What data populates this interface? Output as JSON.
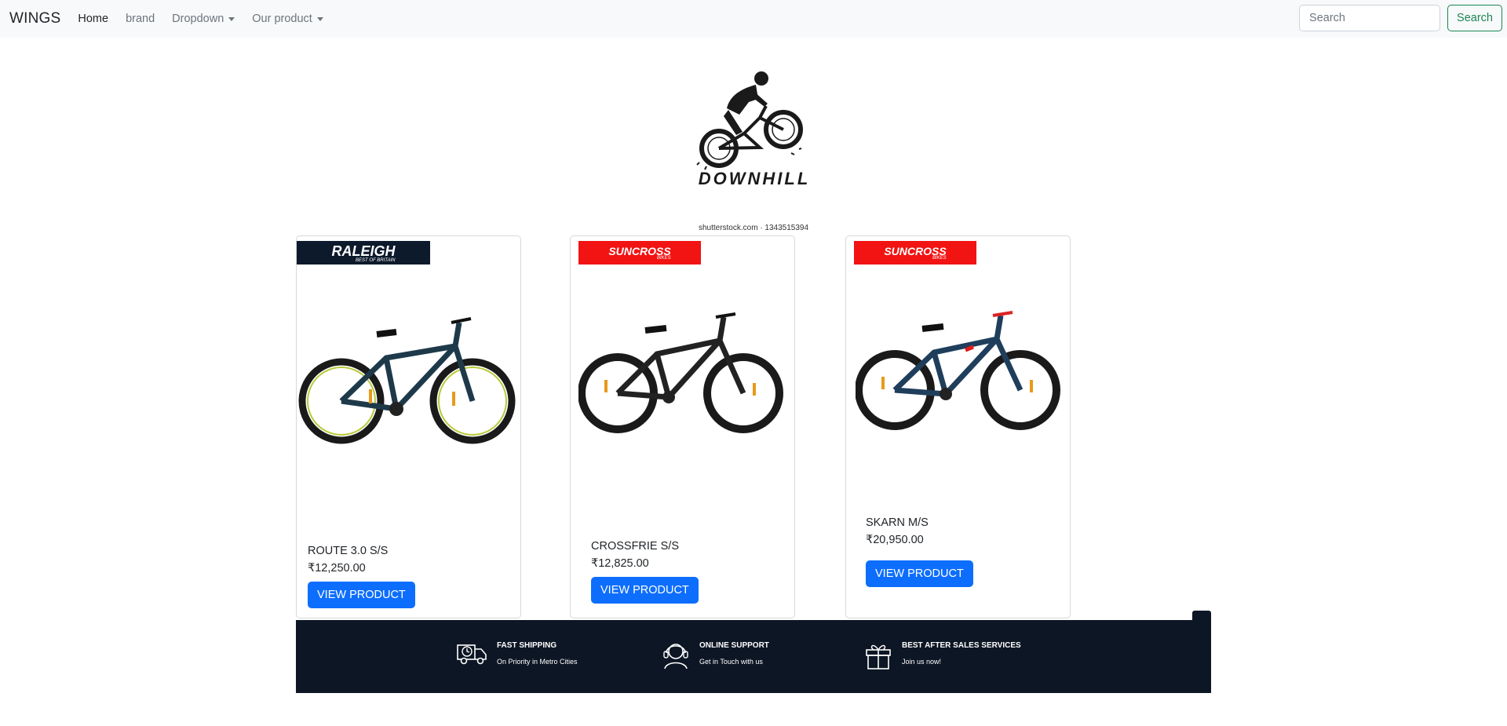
{
  "navbar": {
    "brand": "WINGS",
    "links": [
      {
        "label": "Home"
      },
      {
        "label": "brand"
      },
      {
        "label": "Dropdown"
      },
      {
        "label": "Our product"
      }
    ],
    "search": {
      "placeholder": "Search",
      "button": "Search"
    }
  },
  "hero": {
    "logo_text": "DOWNHILL",
    "caption": "shutterstock.com · 1343515394"
  },
  "products": [
    {
      "brand_badge": "RALEIGH",
      "brand_tagline": "BEST OF BRITAIN",
      "name": "ROUTE 3.0 S/S",
      "price": "₹12,250.00",
      "button": "VIEW PRODUCT"
    },
    {
      "brand_badge": "SUNCROSS",
      "brand_tagline": "BIKES",
      "name": "CROSSFRIE S/S",
      "price": "₹12,825.00",
      "button": "VIEW PRODUCT"
    },
    {
      "brand_badge": "SUNCROSS",
      "brand_tagline": "BIKES",
      "name": "SKARN M/S",
      "price": "₹20,950.00",
      "button": "VIEW PRODUCT"
    }
  ],
  "features": [
    {
      "icon": "truck-clock-icon",
      "title": "FAST SHIPPING",
      "subtitle": "On Priority in Metro Cities"
    },
    {
      "icon": "headset-support-icon",
      "title": "ONLINE SUPPORT",
      "subtitle": "Get in Touch with us"
    },
    {
      "icon": "gift-icon",
      "title": "BEST AFTER SALES SERVICES",
      "subtitle": "Join us now!"
    }
  ],
  "colors": {
    "primary": "#0d6efd",
    "success": "#198754",
    "footer_bg": "#0d1624",
    "suncross_red": "#f21313",
    "raleigh_navy": "#0d1a2b"
  }
}
